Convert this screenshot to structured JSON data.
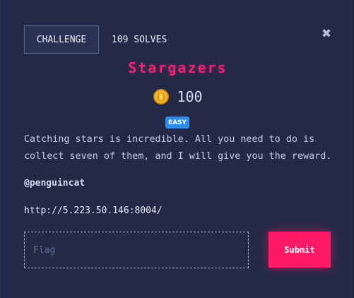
{
  "challenge": {
    "tab_challenge": "CHALLENGE",
    "tab_solves": "109 SOLVES",
    "close_symbol": "✖",
    "title": "Stargazers",
    "points": "100",
    "difficulty": "EASY",
    "description": "Catching stars is incredible. All you need to do is collect seven of them, and I will give you the reward.",
    "author": "@penguincat",
    "link": "http://5.223.50.146:8004/",
    "flag_placeholder": "Flag",
    "submit_label": "Submit"
  },
  "icons": {
    "close": "close-icon",
    "points": "coin-icon"
  },
  "colors": {
    "title": "#f2216f",
    "submit": "#ff1a66",
    "badge": "#2d8ceb",
    "modal_bg": "#222a47"
  }
}
